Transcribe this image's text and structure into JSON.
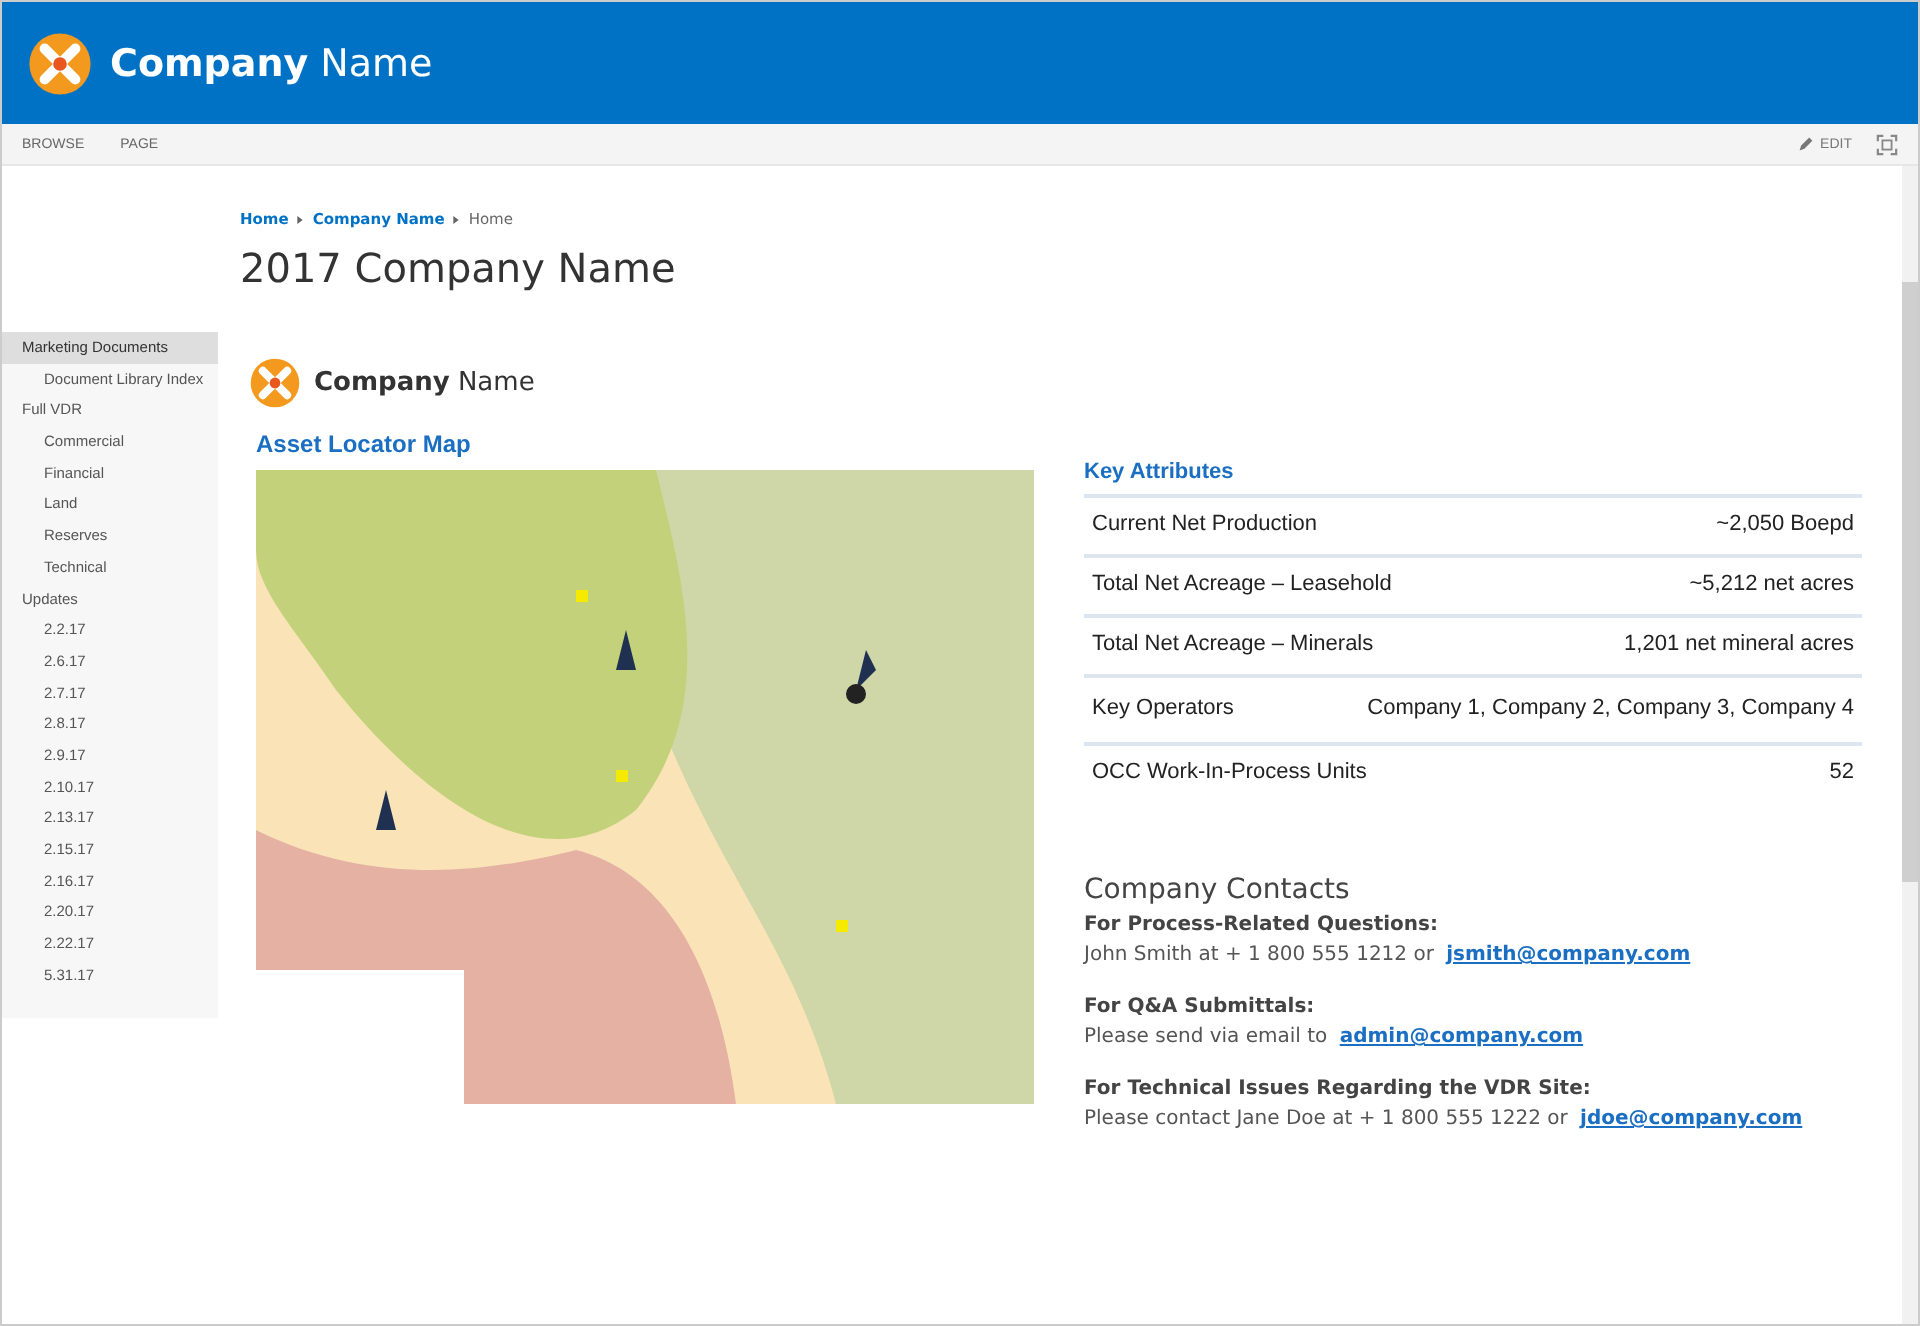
{
  "header": {
    "brand": "**Company** Name"
  },
  "ribbon": {
    "tabs": [
      {
        "label": "BROWSE"
      },
      {
        "label": "PAGE"
      }
    ],
    "edit": "EDIT"
  },
  "sidebar": {
    "items": [
      {
        "label": "Marketing Documents",
        "selected": true,
        "children": [
          {
            "label": "Document Library Index",
            "selected": false
          }
        ]
      },
      {
        "label": "Full VDR",
        "selected": false,
        "children": [
          {
            "label": "Commercial",
            "selected": false
          },
          {
            "label": "Financial",
            "selected": false
          },
          {
            "label": "Land",
            "selected": false
          },
          {
            "label": "Reserves",
            "selected": false
          },
          {
            "label": "Technical",
            "selected": false
          }
        ]
      },
      {
        "label": "Updates",
        "selected": false,
        "children": [
          {
            "label": "2.2.17",
            "selected": false
          },
          {
            "label": "2.6.17",
            "selected": false
          },
          {
            "label": "2.7.17",
            "selected": false
          },
          {
            "label": "2.8.17",
            "selected": false
          },
          {
            "label": "2.9.17",
            "selected": false
          },
          {
            "label": "2.10.17",
            "selected": false
          },
          {
            "label": "2.13.17",
            "selected": false
          },
          {
            "label": "2.15.17",
            "selected": false
          },
          {
            "label": "2.16.17",
            "selected": false
          },
          {
            "label": "2.20.17",
            "selected": false
          },
          {
            "label": "2.22.17",
            "selected": false
          },
          {
            "label": "5.31.17",
            "selected": false
          }
        ]
      }
    ]
  },
  "breadcrumb": [
    {
      "label": "Home",
      "link": true
    },
    {
      "label": "Company Name",
      "link": true
    },
    {
      "label": "Home",
      "link": false
    }
  ],
  "page_title": "2017 Company Name",
  "content_logo": "**Company** Name",
  "map": {
    "title": "Asset Locator Map",
    "kind": "picture"
  },
  "key_attributes": {
    "title": "Key Attributes",
    "rows": [
      {
        "label": "Current Net Production",
        "value": "~2,050 Boepd"
      },
      {
        "label": "Total Net Acreage – Leasehold",
        "value": "~5,212 net acres"
      },
      {
        "label": "Total Net Acreage – Minerals",
        "value": "1,201 net mineral acres"
      },
      {
        "label": "Key Operators",
        "value": "Company 1, Company 2, Company 3, Company 4"
      },
      {
        "label": "OCC Work-In-Process Units",
        "value": "52"
      }
    ]
  },
  "contacts": {
    "title": "Company Contacts",
    "groups": [
      {
        "heading": "For Process-Related Questions:",
        "text": "John Smith at + 1 800 555 1212 or",
        "email": "jsmith@company.com"
      },
      {
        "heading": "For Q&A Submittals:",
        "text": "Please send via email to",
        "email": "admin@company.com"
      },
      {
        "heading": "For Technical Issues Regarding the VDR Site:",
        "text": "Please contact Jane Doe at + 1 800 555 1222 or",
        "email": "jdoe@company.com"
      }
    ]
  }
}
